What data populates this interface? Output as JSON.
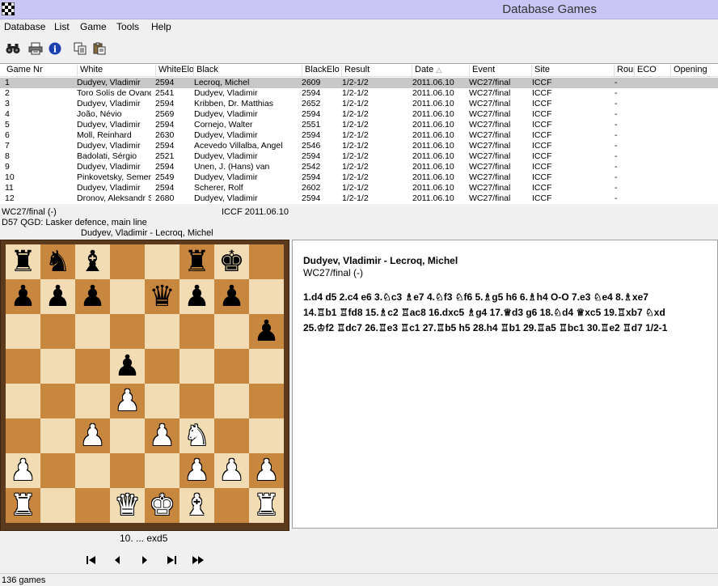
{
  "window": {
    "title": "Database Games"
  },
  "menu": [
    "Database",
    "List",
    "Game",
    "Tools",
    "Help"
  ],
  "toolbar": {
    "icons": [
      "binoculars-icon",
      "print-icon",
      "info-icon",
      "copy-icon",
      "paste-icon"
    ]
  },
  "columns": [
    "Game Nr",
    "White",
    "WhiteElo",
    "Black",
    "BlackElo",
    "Result",
    "Date",
    "Event",
    "Site",
    "Round",
    "ECO",
    "Opening"
  ],
  "games": [
    {
      "nr": "1",
      "white": "Dudyev, Vladimir",
      "welo": "2594",
      "black": "Lecroq, Michel",
      "belo": "2609",
      "result": "1/2-1/2",
      "date": "2011.06.10",
      "event": "WC27/final",
      "site": "ICCF",
      "round": "-"
    },
    {
      "nr": "2",
      "white": "Toro Solís de Ovando",
      "welo": "2541",
      "black": "Dudyev, Vladimir",
      "belo": "2594",
      "result": "1/2-1/2",
      "date": "2011.06.10",
      "event": "WC27/final",
      "site": "ICCF",
      "round": "-"
    },
    {
      "nr": "3",
      "white": "Dudyev, Vladimir",
      "welo": "2594",
      "black": "Kribben, Dr. Matthias",
      "belo": "2652",
      "result": "1/2-1/2",
      "date": "2011.06.10",
      "event": "WC27/final",
      "site": "ICCF",
      "round": "-"
    },
    {
      "nr": "4",
      "white": "João, Névio",
      "welo": "2569",
      "black": "Dudyev, Vladimir",
      "belo": "2594",
      "result": "1/2-1/2",
      "date": "2011.06.10",
      "event": "WC27/final",
      "site": "ICCF",
      "round": "-"
    },
    {
      "nr": "5",
      "white": "Dudyev, Vladimir",
      "welo": "2594",
      "black": "Cornejo, Walter",
      "belo": "2551",
      "result": "1/2-1/2",
      "date": "2011.06.10",
      "event": "WC27/final",
      "site": "ICCF",
      "round": "-"
    },
    {
      "nr": "6",
      "white": "Moll, Reinhard",
      "welo": "2630",
      "black": "Dudyev, Vladimir",
      "belo": "2594",
      "result": "1/2-1/2",
      "date": "2011.06.10",
      "event": "WC27/final",
      "site": "ICCF",
      "round": "-"
    },
    {
      "nr": "7",
      "white": "Dudyev, Vladimir",
      "welo": "2594",
      "black": "Acevedo Villalba, Angel",
      "belo": "2546",
      "result": "1/2-1/2",
      "date": "2011.06.10",
      "event": "WC27/final",
      "site": "ICCF",
      "round": "-"
    },
    {
      "nr": "8",
      "white": "Badolati, Sérgio",
      "welo": "2521",
      "black": "Dudyev, Vladimir",
      "belo": "2594",
      "result": "1/2-1/2",
      "date": "2011.06.10",
      "event": "WC27/final",
      "site": "ICCF",
      "round": "-"
    },
    {
      "nr": "9",
      "white": "Dudyev, Vladimir",
      "welo": "2594",
      "black": "Unen, J. (Hans) van",
      "belo": "2542",
      "result": "1/2-1/2",
      "date": "2011.06.10",
      "event": "WC27/final",
      "site": "ICCF",
      "round": "-"
    },
    {
      "nr": "10",
      "white": "Pinkovetsky, Semen",
      "welo": "2549",
      "black": "Dudyev, Vladimir",
      "belo": "2594",
      "result": "1/2-1/2",
      "date": "2011.06.10",
      "event": "WC27/final",
      "site": "ICCF",
      "round": "-"
    },
    {
      "nr": "11",
      "white": "Dudyev, Vladimir",
      "welo": "2594",
      "black": "Scherer, Rolf",
      "belo": "2602",
      "result": "1/2-1/2",
      "date": "2011.06.10",
      "event": "WC27/final",
      "site": "ICCF",
      "round": "-"
    },
    {
      "nr": "12",
      "white": "Dronov, Aleksandr S.",
      "welo": "2680",
      "black": "Dudyev, Vladimir",
      "belo": "2594",
      "result": "1/2-1/2",
      "date": "2011.06.10",
      "event": "WC27/final",
      "site": "ICCF",
      "round": "-"
    }
  ],
  "selected_game": {
    "event_line": "WC27/final (-)",
    "site_date": "ICCF 2011.06.10",
    "opening": "D57 QGD: Lasker defence, main line",
    "players": "Dudyev, Vladimir - Lecroq, Michel"
  },
  "board": [
    "r n b . . r k .",
    "p p p . q p p .",
    ". . . . . . . p",
    ". . . p . . . .",
    ". . . P . . . .",
    ". . P . P N . .",
    "P . . . . P P P",
    "R . . Q K B . R"
  ],
  "notation": {
    "players": "Dudyev, Vladimir - Lecroq, Michel",
    "event": "WC27/final (-)",
    "lines": [
      "1.d4  d5  2.c4  e6  3.♘c3  ♗e7  4.♘f3  ♘f6  5.♗g5  h6  6.♗h4  O-O  7.e3  ♘e4  8.♗xe7",
      "14.♖b1  ♖fd8  15.♗c2  ♖ac8  16.dxc5  ♗g4  17.♕d3  g6  18.♘d4  ♕xc5  19.♖xb7  ♘xd",
      "25.♔f2  ♖dc7  26.♖e3  ♖c1  27.♖b5  h5  28.h4  ♖b1  29.♖a5  ♖bc1  30.♖e2  ♖d7  1/2-1"
    ]
  },
  "current_move": "10. ... exd5",
  "status": "136 games"
}
